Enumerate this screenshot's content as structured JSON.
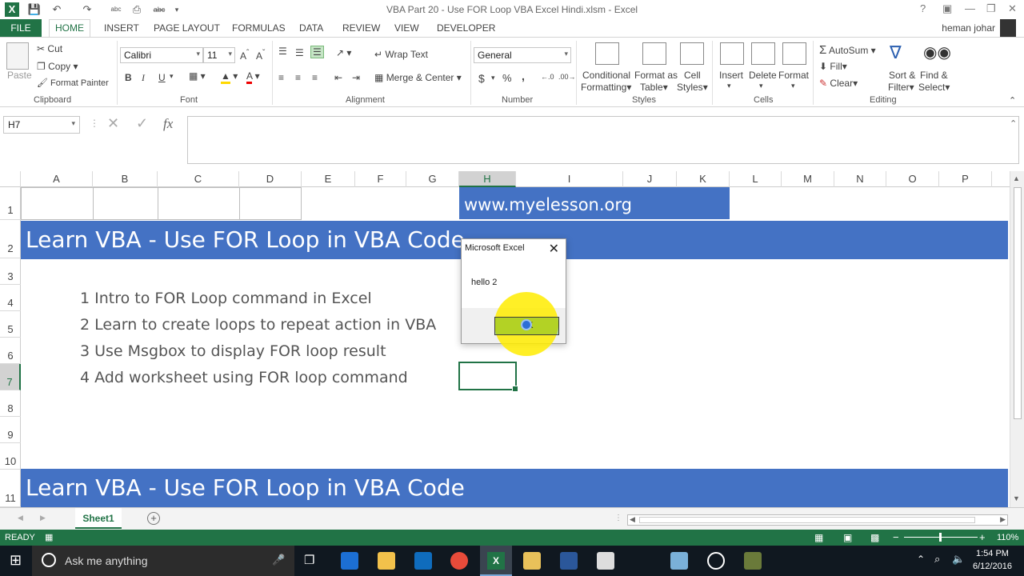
{
  "window": {
    "title": "VBA Part 20 -  Use FOR Loop VBA Excel Hindi.xlsm - Excel",
    "help": "?",
    "minimize": "—",
    "restore": "❐",
    "close": "✕"
  },
  "tabs": [
    "FILE",
    "HOME",
    "INSERT",
    "PAGE LAYOUT",
    "FORMULAS",
    "DATA",
    "REVIEW",
    "VIEW",
    "DEVELOPER"
  ],
  "user": "heman johar",
  "ribbon": {
    "clipboard": {
      "paste": "Paste",
      "cut": "Cut",
      "copy": "Copy",
      "format_painter": "Format Painter",
      "label": "Clipboard"
    },
    "font": {
      "name": "Calibri",
      "size": "11",
      "bold": "B",
      "italic": "I",
      "underline": "U",
      "label": "Font"
    },
    "alignment": {
      "wrap": "Wrap Text",
      "merge": "Merge & Center",
      "label": "Alignment"
    },
    "number": {
      "format": "General",
      "currency": "$",
      "percent": "%",
      "comma": ",",
      "label": "Number"
    },
    "styles": {
      "conditional": "Conditional",
      "conditional2": "Formatting",
      "format_as": "Format as",
      "format_as2": "Table",
      "cell": "Cell",
      "cell2": "Styles",
      "label": "Styles"
    },
    "cells": {
      "insert": "Insert",
      "delete": "Delete",
      "format": "Format",
      "label": "Cells"
    },
    "editing": {
      "autosum": "AutoSum",
      "fill": "Fill",
      "clear": "Clear",
      "sort": "Sort &",
      "sort2": "Filter",
      "find": "Find &",
      "find2": "Select",
      "label": "Editing"
    }
  },
  "formula_bar": {
    "namebox": "H7",
    "fx": "fx",
    "value": ""
  },
  "columns": [
    "A",
    "B",
    "C",
    "D",
    "E",
    "F",
    "G",
    "H",
    "I",
    "J",
    "K",
    "L",
    "M",
    "N",
    "O",
    "P"
  ],
  "rows": [
    "1",
    "2",
    "3",
    "4",
    "5",
    "6",
    "7",
    "8",
    "9",
    "10",
    "11"
  ],
  "selected_column": "H",
  "selected_row": "7",
  "sheet": {
    "website": "www.myelesson.org",
    "banner": "Learn VBA - Use FOR Loop  in  VBA Code",
    "items": [
      "1  Intro to FOR Loop command in Excel",
      "2  Learn to create loops to repeat action in VBA",
      "3  Use Msgbox to display FOR loop result",
      "4  Add worksheet using FOR loop command"
    ]
  },
  "dialog": {
    "title": "Microsoft Excel",
    "message": "hello  2",
    "ok": "OK"
  },
  "sheet_tabs": [
    "Sheet1"
  ],
  "status": {
    "ready": "READY",
    "zoom": "110%"
  },
  "taskbar": {
    "search_placeholder": "Ask me anything",
    "time": "1:54 PM",
    "date": "6/12/2016"
  },
  "colors": {
    "excel_green": "#217346",
    "banner_blue": "#4472c4",
    "highlight_yellow": "#ffec00"
  }
}
